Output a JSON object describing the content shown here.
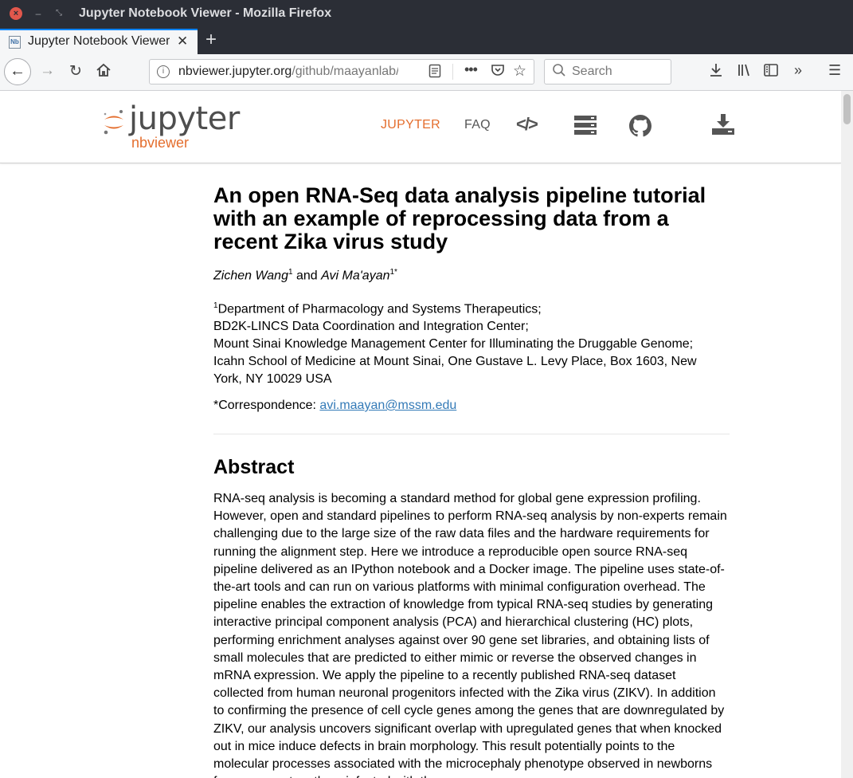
{
  "window": {
    "title": "Jupyter Notebook Viewer - Mozilla Firefox"
  },
  "tab": {
    "title": "Jupyter Notebook Viewer",
    "favicon": "Nb"
  },
  "urlbar": {
    "host": "nbviewer.jupyter.org",
    "path": "/github/maayanlab/"
  },
  "searchbar": {
    "placeholder": "Search"
  },
  "header": {
    "logo_word": "jupyter",
    "logo_sub": "nbviewer",
    "nav": {
      "jupyter": "JUPYTER",
      "faq": "FAQ"
    },
    "code_icon": "</>"
  },
  "article": {
    "title": "An open RNA-Seq data analysis pipeline tutorial with an example of reprocessing data from a recent Zika virus study",
    "author1": "Zichen Wang",
    "author1_sup": "1",
    "and": " and ",
    "author2": "Avi Ma'ayan",
    "author2_sup": "1*",
    "affil_sup": "1",
    "affiliations": [
      "Department of Pharmacology and Systems Therapeutics;",
      "BD2K-LINCS Data Coordination and Integration Center;",
      "Mount Sinai Knowledge Management Center for Illuminating the Druggable Genome;",
      "Icahn School of Medicine at Mount Sinai, One Gustave L. Levy Place, Box 1603, New York, NY 10029 USA"
    ],
    "correspondence_label": "*Correspondence: ",
    "correspondence_email": "avi.maayan@mssm.edu",
    "abstract_heading": "Abstract",
    "abstract": "RNA-seq analysis is becoming a standard method for global gene expression profiling. However, open and standard pipelines to perform RNA-seq analysis by non-experts remain challenging due to the large size of the raw data files and the hardware requirements for running the alignment step. Here we introduce a reproducible open source RNA-seq pipeline delivered as an IPython notebook and a Docker image. The pipeline uses state-of-the-art tools and can run on various platforms with minimal configuration overhead. The pipeline enables the extraction of knowledge from typical RNA-seq studies by generating interactive principal component analysis (PCA) and hierarchical clustering (HC) plots, performing enrichment analyses against over 90 gene set libraries, and obtaining lists of small molecules that are predicted to either mimic or reverse the observed changes in mRNA expression. We apply the pipeline to a recently published RNA-seq dataset collected from human neuronal progenitors infected with the Zika virus (ZIKV). In addition to confirming the presence of cell cycle genes among the genes that are downregulated by ZIKV, our analysis uncovers significant overlap with upregulated genes that when knocked out in mice induce defects in brain morphology. This result potentially points to the molecular processes associated with the microcephaly phenotype observed in newborns from pregnant mothers infected with the"
  },
  "colors": {
    "brand_orange": "#e46e2e",
    "link_blue": "#337ab7",
    "titlebar": "#2b2e36",
    "tab_accent": "#0a84ff"
  }
}
